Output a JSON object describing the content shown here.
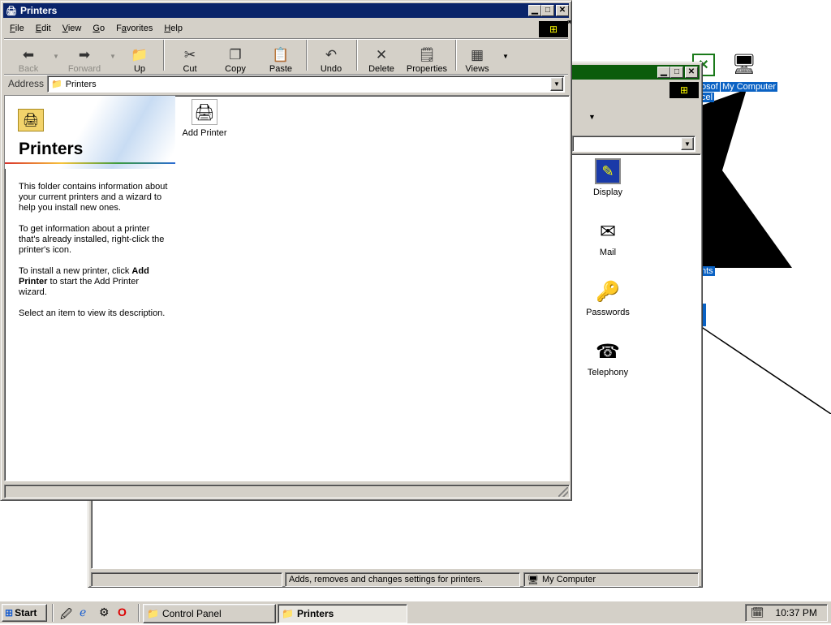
{
  "desktop": {
    "icons": [
      {
        "label": "My Computer",
        "icon": "my-computer-icon"
      },
      {
        "label": "cel",
        "icon": "excel-icon"
      },
      {
        "label": "osof",
        "icon": "excel-label-fragment"
      },
      {
        "label": "nts",
        "icon": "documents-label-fragment"
      }
    ]
  },
  "control_panel": {
    "title_fragment": "",
    "icons": [
      {
        "label": "Display",
        "icon": "display-icon"
      },
      {
        "label": "Mail",
        "icon": "mail-icon"
      },
      {
        "label": "Passwords",
        "icon": "passwords-icon"
      },
      {
        "label": "Telephony",
        "icon": "telephony-icon"
      }
    ],
    "status_text": "Adds, removes and changes settings for printers.",
    "status_zone": "My Computer"
  },
  "printers": {
    "title": "Printers",
    "menu": [
      {
        "label": "File",
        "accel": "F",
        "rest": "ile"
      },
      {
        "label": "Edit",
        "accel": "E",
        "rest": "dit"
      },
      {
        "label": "View",
        "accel": "V",
        "rest": "iew"
      },
      {
        "label": "Go",
        "accel": "G",
        "rest": "o"
      },
      {
        "label": "Favorites",
        "accel": "a",
        "pre": "F",
        "rest": "vorites"
      },
      {
        "label": "Help",
        "accel": "H",
        "rest": "elp"
      }
    ],
    "toolbar": {
      "back": "Back",
      "forward": "Forward",
      "up": "Up",
      "cut": "Cut",
      "copy": "Copy",
      "paste": "Paste",
      "undo": "Undo",
      "delete": "Delete",
      "properties": "Properties",
      "views": "Views"
    },
    "address_label": "Address",
    "address_value": "Printers",
    "panel_title": "Printers",
    "panel_text": [
      "This folder contains information about your current printers and a wizard to help you install new ones.",
      "To get information about a printer that's already installed, right-click the printer's icon."
    ],
    "panel_install_pre": "To install a new printer, click",
    "panel_install_bold": "Add Printer",
    "panel_install_post": "to start the Add Printer wizard.",
    "panel_select": "Select an item to view its description.",
    "item_add_printer": "Add Printer"
  },
  "taskbar": {
    "start": "Start",
    "tasks": [
      {
        "label": "Control Panel"
      },
      {
        "label": "Printers"
      }
    ],
    "clock": "10:37 PM"
  },
  "colors": {
    "title_active": "#0a246a",
    "title_inactive": "#808080",
    "control_panel_title": "#0b5c0b",
    "desktop": "#ffffff",
    "face": "#d4d0c8",
    "selection": "#0a62c4"
  }
}
